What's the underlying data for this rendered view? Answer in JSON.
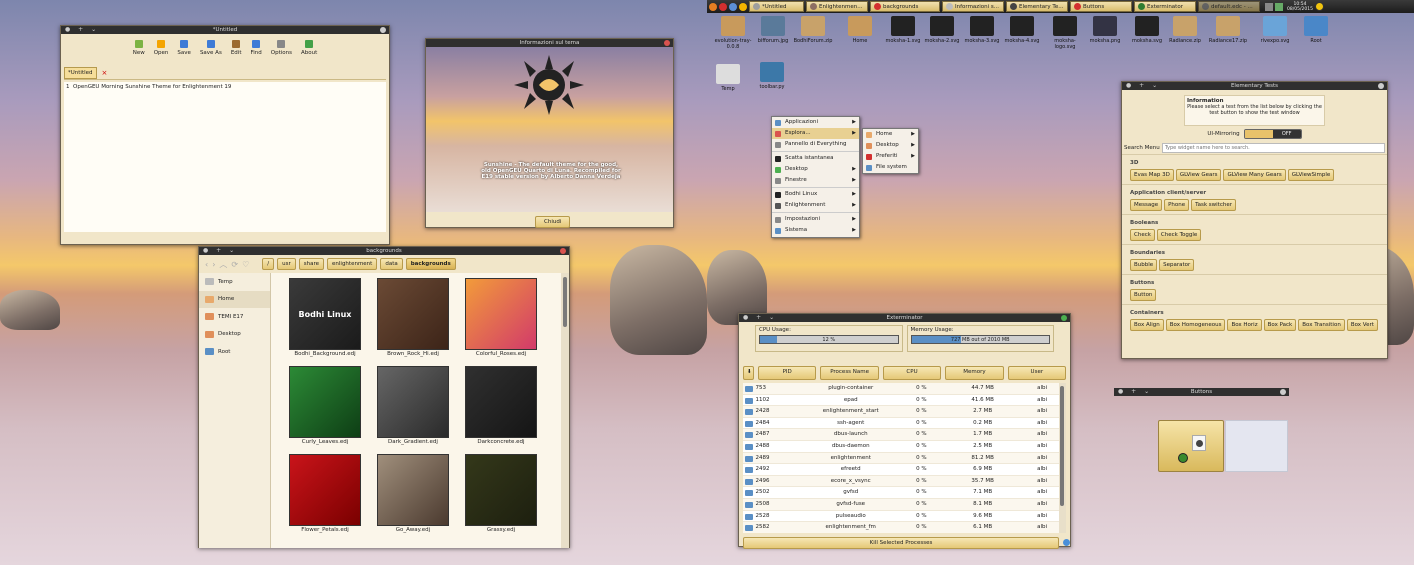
{
  "editor": {
    "title": "*Untitled",
    "toolbar": [
      "New",
      "Open",
      "Save",
      "Save As",
      "Edit",
      "Find",
      "Options",
      "About"
    ],
    "tab": "*Untitled",
    "tab_close": "×",
    "line_num": "1",
    "text": "OpenGEU Morning Sunshine Theme for Enlightenment 19"
  },
  "about": {
    "title": "Informazioni sul tema",
    "desc": "Sunshine - The default theme for the good, old OpenGEU Quarto di Luna. Recompiled for E19 stable version by Alberto Danna Verdeja",
    "close": "Chiudi"
  },
  "fm": {
    "title": "backgrounds",
    "path": [
      "/",
      "usr",
      "share",
      "enlightenment",
      "data",
      "backgrounds"
    ],
    "places": [
      "Temp",
      "Home",
      "TEMI E17",
      "Desktop",
      "Root"
    ],
    "files": [
      {
        "name": "Bodhi_Background.edj",
        "c1": "#1b1b1b",
        "c2": "#3a3a3a",
        "label": "Bodhi Linux"
      },
      {
        "name": "Brown_Rock_Hi.edj",
        "c1": "#3c2418",
        "c2": "#6b4a35",
        "label": ""
      },
      {
        "name": "Colorful_Roses.edj",
        "c1": "#d23a6a",
        "c2": "#f29b3a",
        "label": ""
      },
      {
        "name": "Curly_Leaves.edj",
        "c1": "#0e3e15",
        "c2": "#2c8a36",
        "label": ""
      },
      {
        "name": "Dark_Gradient.edj",
        "c1": "#2a2a2a",
        "c2": "#666",
        "label": ""
      },
      {
        "name": "Darkconcrete.edj",
        "c1": "#151515",
        "c2": "#303030",
        "label": ""
      },
      {
        "name": "Flower_Petals.edj",
        "c1": "#7a0000",
        "c2": "#c9141a",
        "label": ""
      },
      {
        "name": "Go_Away.edj",
        "c1": "#4b3a2f",
        "c2": "#a08f7c",
        "label": ""
      },
      {
        "name": "Grassy.edj",
        "c1": "#1d1f0f",
        "c2": "#34381a",
        "label": ""
      }
    ]
  },
  "taskbar": {
    "tasks": [
      "*Untitled",
      "Enlightenmen...",
      "backgrounds",
      "Informazioni s...",
      "Elementary Te...",
      "Buttons",
      "Exterminator",
      "default.edc - ..."
    ],
    "time": "10:54",
    "date": "08/05/2015"
  },
  "desktop": {
    "icons": [
      "evolution-tray-0.0.8",
      "bifforum.jpg",
      "BodhiForum.zip",
      "Home",
      "moksha-1.svg",
      "moksha-2.svg",
      "moksha-3.svg",
      "moksha-4.svg",
      "moksha-logo.svg",
      "moksha.png",
      "moksha.svg",
      "Radiance.zip",
      "Radiance17.zip",
      "rivexpo.svg",
      "Root",
      "Temp",
      "toolbar.py"
    ]
  },
  "menu": {
    "items": [
      "Applicazioni",
      "Esplora...",
      "Pannello di Everything",
      "Scatta istantanea",
      "Desktop",
      "Finestre",
      "Bodhi Linux",
      "Enlightenment",
      "Impostazioni",
      "Sistema"
    ],
    "sub": [
      "Home",
      "Desktop",
      "Preferiti",
      "File system"
    ]
  },
  "elm": {
    "title": "Elementary Tests",
    "info_title": "Information",
    "info_text": "Please select a test from the list below by clicking the test button to show the test window",
    "mirroring": "UI-Mirroring",
    "toggle": "OFF",
    "search_label": "Search Menu",
    "search_ph": "Type widget name here to search.",
    "sections": [
      {
        "name": "3D",
        "items": [
          "Evas Map 3D",
          "GLView Gears",
          "GLView Many Gears",
          "GLViewSimple"
        ]
      },
      {
        "name": "Application client/server",
        "items": [
          "Message",
          "Phone",
          "Task switcher"
        ]
      },
      {
        "name": "Booleans",
        "items": [
          "Check",
          "Check Toggle"
        ]
      },
      {
        "name": "Boundaries",
        "items": [
          "Bubble",
          "Separator"
        ]
      },
      {
        "name": "Buttons",
        "items": [
          "Button"
        ]
      },
      {
        "name": "Containers",
        "items": [
          "Box Align",
          "Box Homogeneous",
          "Box Horiz",
          "Box Pack",
          "Box Transition",
          "Box Vert"
        ]
      }
    ]
  },
  "buttons": {
    "title": "Buttons"
  },
  "ext": {
    "title": "Exterminator",
    "cpu_label": "CPU Usage:",
    "cpu_value": "12 %",
    "cpu_frac": 0.12,
    "mem_label": "Memory Usage:",
    "mem_value": "727 MB out of 2010 MB",
    "mem_frac": 0.36,
    "headers": [
      "PID",
      "Process Name",
      "CPU",
      "Memory",
      "User"
    ],
    "kill": "Kill Selected Processes",
    "rows": [
      [
        "753",
        "plugin-container",
        "0 %",
        "44.7 MB",
        "albi"
      ],
      [
        "1102",
        "epad",
        "0 %",
        "41.6 MB",
        "albi"
      ],
      [
        "2428",
        "enlightenment_start",
        "0 %",
        "2.7 MB",
        "albi"
      ],
      [
        "2484",
        "ssh-agent",
        "0 %",
        "0.2 MB",
        "albi"
      ],
      [
        "2487",
        "dbus-launch",
        "0 %",
        "1.7 MB",
        "albi"
      ],
      [
        "2488",
        "dbus-daemon",
        "0 %",
        "2.5 MB",
        "albi"
      ],
      [
        "2489",
        "enlightenment",
        "0 %",
        "81.2 MB",
        "albi"
      ],
      [
        "2492",
        "efreetd",
        "0 %",
        "6.9 MB",
        "albi"
      ],
      [
        "2496",
        "ecore_x_vsync",
        "0 %",
        "35.7 MB",
        "albi"
      ],
      [
        "2502",
        "gvfsd",
        "0 %",
        "7.1 MB",
        "albi"
      ],
      [
        "2508",
        "gvfsd-fuse",
        "0 %",
        "8.1 MB",
        "albi"
      ],
      [
        "2528",
        "pulseaudio",
        "0 %",
        "9.6 MB",
        "albi"
      ],
      [
        "2582",
        "enlightenment_fm",
        "0 %",
        "6.1 MB",
        "albi"
      ]
    ]
  }
}
